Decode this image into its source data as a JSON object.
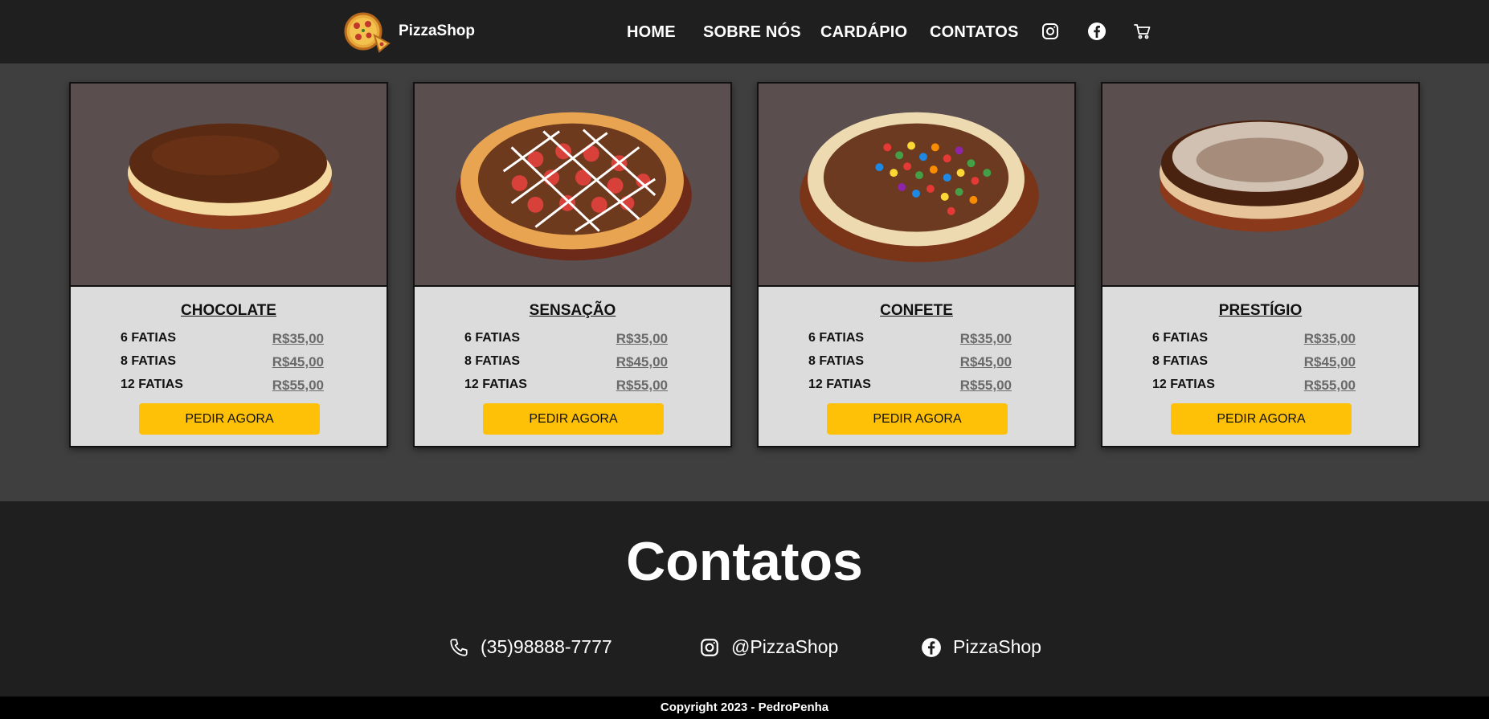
{
  "header": {
    "brand": "PizzaShop",
    "nav": [
      "HOME",
      "SOBRE NÓS",
      "CARDÁPIO",
      "CONTATOS"
    ],
    "icons": [
      "instagram-icon",
      "facebook-icon",
      "cart-icon"
    ]
  },
  "cards": [
    {
      "title": "CHOCOLATE",
      "rows": [
        {
          "label": "6 FATIAS",
          "price": "R$35,00"
        },
        {
          "label": "8 FATIAS",
          "price": "R$45,00"
        },
        {
          "label": "12 FATIAS",
          "price": "R$55,00"
        }
      ],
      "button": "PEDIR AGORA"
    },
    {
      "title": "SENSAÇÃO",
      "rows": [
        {
          "label": "6 FATIAS",
          "price": "R$35,00"
        },
        {
          "label": "8 FATIAS",
          "price": "R$45,00"
        },
        {
          "label": "12 FATIAS",
          "price": "R$55,00"
        }
      ],
      "button": "PEDIR AGORA"
    },
    {
      "title": "CONFETE",
      "rows": [
        {
          "label": "6 FATIAS",
          "price": "R$35,00"
        },
        {
          "label": "8 FATIAS",
          "price": "R$45,00"
        },
        {
          "label": "12 FATIAS",
          "price": "R$55,00"
        }
      ],
      "button": "PEDIR AGORA"
    },
    {
      "title": "PRESTÍGIO",
      "rows": [
        {
          "label": "6 FATIAS",
          "price": "R$35,00"
        },
        {
          "label": "8 FATIAS",
          "price": "R$45,00"
        },
        {
          "label": "12 FATIAS",
          "price": "R$55,00"
        }
      ],
      "button": "PEDIR AGORA"
    }
  ],
  "contacts": {
    "title": "Contatos",
    "phone": "(35)98888-7777",
    "instagram": "@PizzaShop",
    "facebook": "PizzaShop"
  },
  "footer": "Copyright 2023 - PedroPenha",
  "colors": {
    "header_bg": "#1f1f1f",
    "page_bg": "#3f3f3f",
    "card_bg": "#dcdcdc",
    "image_bg": "#5a4e4e",
    "button": "#ffc107"
  }
}
